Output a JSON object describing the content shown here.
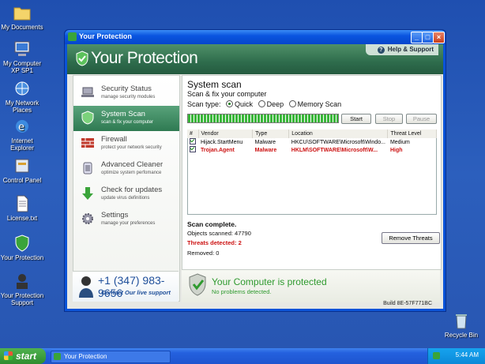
{
  "desktop": {
    "icons": [
      {
        "label": "My Documents"
      },
      {
        "label": "My Computer XP SP1"
      },
      {
        "label": "My Network Places"
      },
      {
        "label": "Internet Explorer"
      },
      {
        "label": "Control Panel"
      },
      {
        "label": "License.txt"
      },
      {
        "label": "Your Protection"
      },
      {
        "label": "Your Protection Support"
      },
      {
        "label": "Recycle Bin"
      }
    ]
  },
  "window": {
    "title": "Your Protection",
    "app_title": "Your Protection",
    "help_label": "Help & Support",
    "build": "Build 8E-57F771BC"
  },
  "nav": {
    "items": [
      {
        "label": "Security Status",
        "sub": "manage security modules",
        "icon": "laptop-icon"
      },
      {
        "label": "System Scan",
        "sub": "scan & fix your computer",
        "icon": "scan-shield-icon"
      },
      {
        "label": "Firewall",
        "sub": "protect your network security",
        "icon": "firewall-icon"
      },
      {
        "label": "Advanced Cleaner",
        "sub": "optimize system perfomance",
        "icon": "cleaner-icon"
      },
      {
        "label": "Check for updates",
        "sub": "update virus definitions",
        "icon": "update-arrow-icon"
      },
      {
        "label": "Settings",
        "sub": "manage your preferences",
        "icon": "gear-icon"
      }
    ],
    "active_index": 1
  },
  "support": {
    "phone": "+1 (347) 983-9656",
    "contact": "Contact Our live support"
  },
  "scan": {
    "title": "System scan",
    "subtitle": "Scan & fix your computer",
    "scan_type_label": "Scan type:",
    "options": [
      "Quick",
      "Deep",
      "Memory Scan"
    ],
    "selected": "Quick",
    "progress": 100,
    "start_label": "Start",
    "stop_label": "Stop",
    "pause_label": "Pause",
    "columns": [
      "#",
      "Vendor",
      "Type",
      "Location",
      "Threat Level"
    ],
    "rows": [
      {
        "vendor": "Hijack.StartMenu",
        "type": "Malware",
        "location": "HKCU\\SOFTWARE\\Microsoft\\Windo...",
        "level": "Medium"
      },
      {
        "vendor": "Trojan.Agent",
        "type": "Malware",
        "location": "HKLM\\SOFTWARE\\Microsoft\\W...",
        "level": "High"
      }
    ],
    "complete": "Scan complete.",
    "scanned": "Objects scanned: 47790",
    "detected": "Threats detected: 2",
    "removed": "Removed: 0",
    "remove_label": "Remove Threats"
  },
  "status": {
    "title": "Your Computer is protected",
    "sub": "No problems detected."
  },
  "taskbar": {
    "start": "start",
    "task": "Your Protection",
    "clock": "5:44 AM"
  },
  "colors": {
    "accent": "#2f7a52",
    "danger": "#cc1111",
    "ok": "#2f9a2f"
  }
}
